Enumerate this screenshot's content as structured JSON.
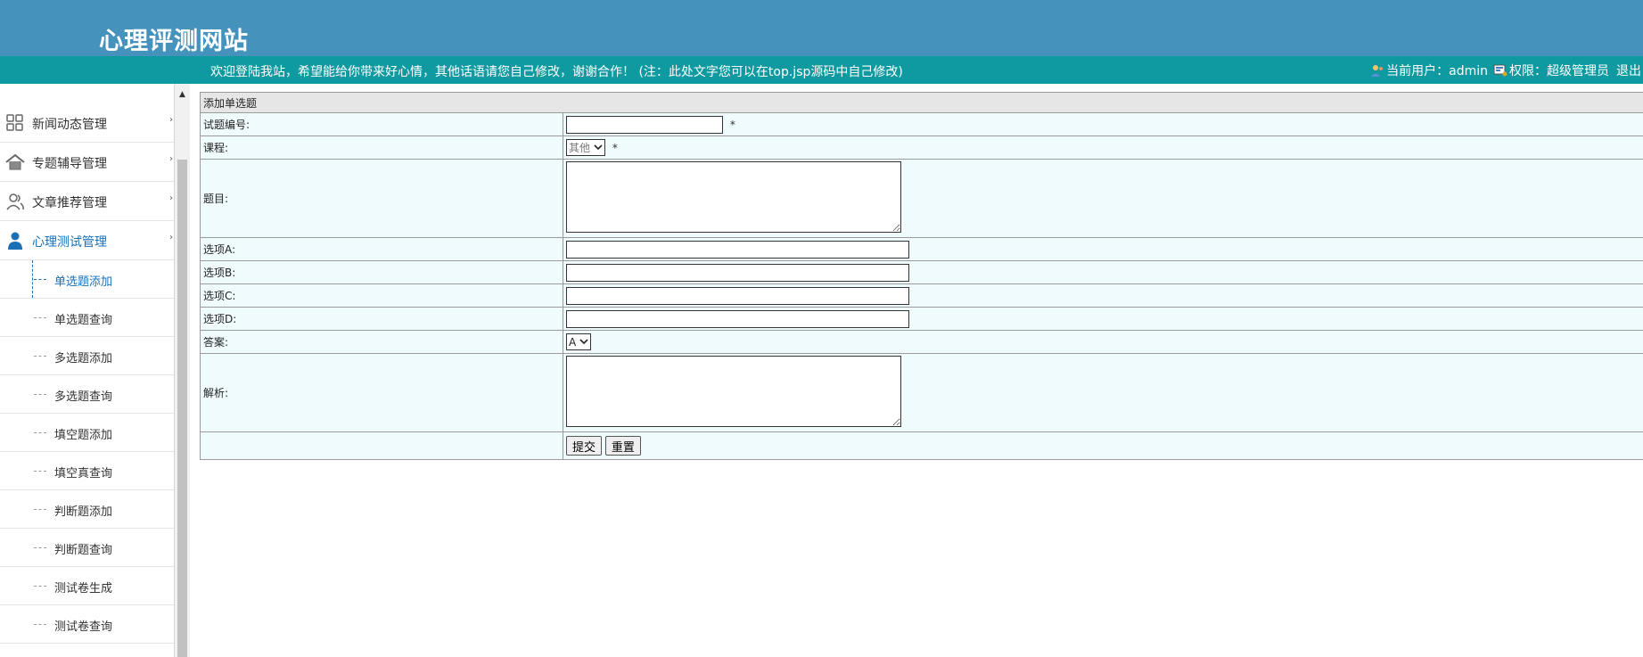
{
  "header": {
    "site_title": "心理评测网站"
  },
  "welcome_bar": {
    "message": "欢迎登陆我站，希望能给你带来好心情，其他话语请您自己修改，谢谢合作！ (注：此处文字您可以在top.jsp源码中自己修改)",
    "user_label": "当前用户：admin",
    "role_label": "权限：超级管理员",
    "logout": "退出"
  },
  "sidebar": {
    "menus": [
      {
        "label": "新闻动态管理",
        "icon": "grid-icon"
      },
      {
        "label": "专题辅导管理",
        "icon": "home-icon"
      },
      {
        "label": "文章推荐管理",
        "icon": "users-icon"
      },
      {
        "label": "心理测试管理",
        "icon": "person-icon"
      }
    ],
    "sub_items": [
      "单选题添加",
      "单选题查询",
      "多选题添加",
      "多选题查询",
      "填空题添加",
      "填空真查询",
      "判断题添加",
      "判断题查询",
      "测试卷生成",
      "测试卷查询"
    ]
  },
  "form": {
    "title": "添加单选题",
    "fields": {
      "number": "试题编号:",
      "course": "课程:",
      "question": "题目:",
      "option_a": "选项A:",
      "option_b": "选项B:",
      "option_c": "选项C:",
      "option_d": "选项D:",
      "answer": "答案:",
      "analysis": "解析:"
    },
    "required_mark": "*",
    "course_selected": "其他",
    "answer_selected": "A",
    "submit": "提交",
    "reset": "重置"
  },
  "colors": {
    "header": "#4592bd",
    "welcome_bar": "#0e9aa0",
    "form_bg": "#f0fbfd",
    "active_menu": "#1b6fb5"
  }
}
